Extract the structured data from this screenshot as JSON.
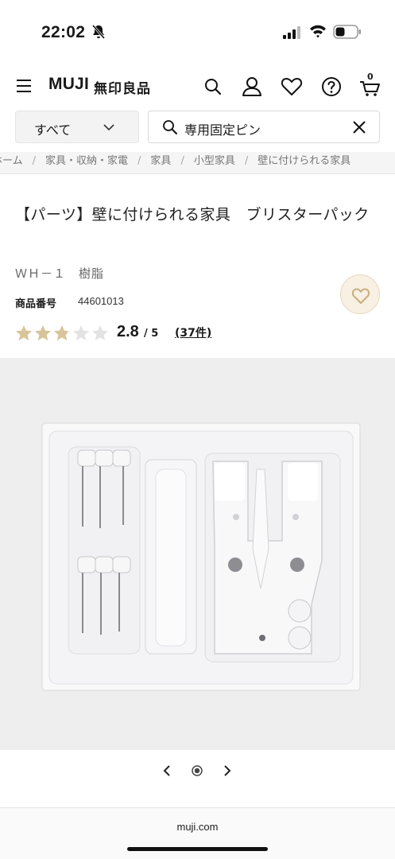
{
  "status_bar": {
    "time": "22:02",
    "icons": [
      "bell-slash-icon",
      "cellular-signal-icon",
      "wifi-icon",
      "battery-icon"
    ]
  },
  "header": {
    "logo": "MUJI",
    "logo_jp": "無印良品",
    "cart_count": "0",
    "icons": [
      "menu-icon",
      "search-icon",
      "account-icon",
      "favorites-icon",
      "help-icon",
      "cart-icon"
    ]
  },
  "search": {
    "category": "すべて",
    "query": "専用固定ピン"
  },
  "breadcrumb": {
    "items": [
      "ホーム",
      "家具・収納・家電",
      "家具",
      "小型家具",
      "壁に付けられる家具"
    ]
  },
  "product": {
    "title": "【パーツ】壁に付けられる家具　ブリスターパック",
    "spec": "ＷＨ－１　樹脂",
    "number_label": "商品番号",
    "number_value": "44601013",
    "rating": {
      "value": "2.8",
      "max_text": "/ 5",
      "stars": 2.8,
      "review_count": "(37件)"
    }
  },
  "colors": {
    "star_filled": "#d8c49a",
    "star_empty": "#e3e3e3",
    "fav_bg": "#f7f0e3",
    "image_bg": "#eeeeee"
  },
  "footer": {
    "url": "muji.com"
  }
}
